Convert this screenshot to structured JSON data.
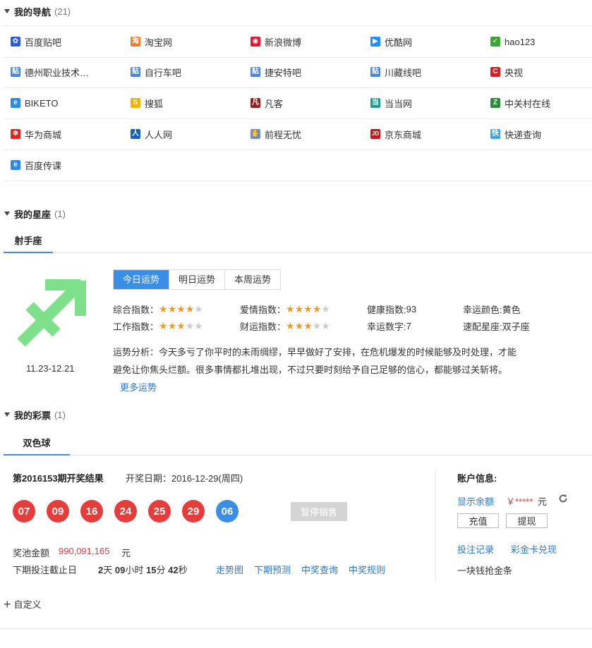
{
  "nav": {
    "title": "我的导航",
    "count": "(21)",
    "rows": [
      [
        {
          "label": "百度贴吧",
          "icon": "baidu-paw-icon"
        },
        {
          "label": "淘宝网",
          "icon": "taobao-icon"
        },
        {
          "label": "新浪微博",
          "icon": "weibo-icon"
        },
        {
          "label": "优酷网",
          "icon": "youku-icon"
        },
        {
          "label": "hao123",
          "icon": "hao123-icon"
        }
      ],
      [
        {
          "label": "德州职业技术…",
          "icon": "bar-icon"
        },
        {
          "label": "自行车吧",
          "icon": "bar-icon"
        },
        {
          "label": "捷安特吧",
          "icon": "bar-icon"
        },
        {
          "label": "川藏线吧",
          "icon": "bar-icon"
        },
        {
          "label": "央视",
          "icon": "cctv-icon"
        }
      ],
      [
        {
          "label": "BIKETO",
          "icon": "ie-icon"
        },
        {
          "label": "搜狐",
          "icon": "sohu-icon"
        },
        {
          "label": "凡客",
          "icon": "vancl-icon"
        },
        {
          "label": "当当网",
          "icon": "dangdang-icon"
        },
        {
          "label": "中关村在线",
          "icon": "zol-icon"
        }
      ],
      [
        {
          "label": "华为商城",
          "icon": "huawei-icon"
        },
        {
          "label": "人人网",
          "icon": "renren-icon"
        },
        {
          "label": "前程无忧",
          "icon": "hand-icon"
        },
        {
          "label": "京东商城",
          "icon": "jd-icon"
        },
        {
          "label": "快递查询",
          "icon": "kuaidi-icon"
        }
      ],
      [
        {
          "label": "百度传课",
          "icon": "ie-icon"
        }
      ]
    ]
  },
  "horoscope": {
    "title": "我的星座",
    "count": "(1)",
    "tab": "射手座",
    "date_range": "11.23-12.21",
    "segments": [
      "今日运势",
      "明日运势",
      "本周运势"
    ],
    "labels": {
      "overall": "综合指数：",
      "love": "爱情指数：",
      "health": "健康指数:",
      "health_val": "93",
      "lucky_color": "幸运颜色:",
      "lucky_color_val": "黄色",
      "work": "工作指数：",
      "wealth": "财运指数：",
      "lucky_num": "幸运数字:",
      "lucky_num_val": "7",
      "match": "速配星座:",
      "match_val": "双子座"
    },
    "ratings": {
      "overall": 4,
      "love": 4,
      "work": 3,
      "wealth": 3,
      "max": 5
    },
    "analysis_line1": "运势分析：今天多亏了你平时的未雨绸缪，早早做好了安排，在危机爆发的时候能够及时处理，才能",
    "analysis_line2": "避免让你焦头烂额。很多事情都扎堆出现，不过只要时刻给予自己足够的信心，都能够过关斩将。",
    "more": "更多运势",
    "symbol_color": "#7ee08a"
  },
  "lottery": {
    "title": "我的彩票",
    "count": "(1)",
    "tab": "双色球",
    "issue": "第2016153期开奖结果",
    "draw_date": "开奖日期：2016-12-29(周四)",
    "red_balls": [
      "07",
      "09",
      "16",
      "24",
      "25",
      "29"
    ],
    "blue_ball": "06",
    "paused": "暂停销售",
    "pool_label": "奖池金额",
    "pool_value": "990,091,165",
    "pool_unit": "元",
    "deadline_label": "下期投注截止日",
    "deadline": {
      "d": "2",
      "d_u": "天",
      "h": "09",
      "h_u": "小时",
      "m": "15",
      "m_u": "分",
      "s": "42",
      "s_u": "秒"
    },
    "links": [
      "走势图",
      "下期预测",
      "中奖查询",
      "中奖规则"
    ],
    "account": {
      "title": "账户信息:",
      "show_balance": "显示余额",
      "balance": "￥*****",
      "unit": "元",
      "recharge": "充值",
      "withdraw": "提现",
      "bet_record": "投注记录",
      "card": "彩金卡兑现",
      "promo": "一块钱抢金条"
    },
    "red_color": "#e63c3c",
    "blue_color": "#3a8ee6"
  },
  "custom": {
    "label": "自定义"
  }
}
